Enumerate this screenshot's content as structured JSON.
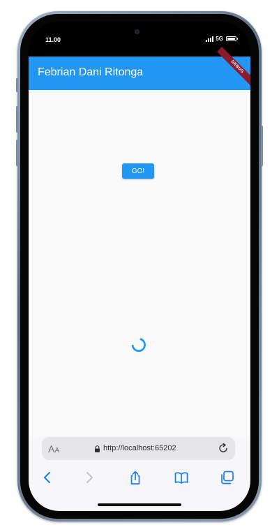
{
  "status_bar": {
    "time": "11.00",
    "network": "5G"
  },
  "app_bar": {
    "title": "Febrian Dani Ritonga",
    "banner": "DEBUG"
  },
  "main": {
    "go_button_label": "GO!"
  },
  "browser": {
    "text_size_big": "A",
    "text_size_small": "A",
    "url": "http://localhost:65202"
  },
  "colors": {
    "primary": "#2196f3",
    "debug_banner": "#8b1a2f",
    "ios_blue": "#1a7cf5"
  },
  "icons": [
    "signal-icon",
    "battery-icon",
    "lock-icon",
    "reload-icon",
    "back-icon",
    "forward-icon",
    "share-icon",
    "bookmarks-icon",
    "tabs-icon",
    "loading-spinner"
  ]
}
